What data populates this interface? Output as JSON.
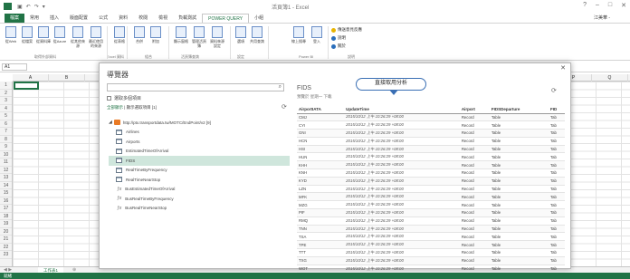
{
  "window": {
    "title": "活頁簿1 - Excel",
    "signin": "江美華 -"
  },
  "ribbon_tabs": [
    "檔案",
    "常用",
    "插入",
    "版面配置",
    "公式",
    "資料",
    "校閱",
    "檢視",
    "負載測試",
    "POWER QUERY",
    "小組"
  ],
  "ribbon": {
    "buttons": [
      {
        "label": "從Web",
        "icon": "web-icon"
      },
      {
        "label": "從檔案",
        "icon": "file-icon"
      },
      {
        "label": "從資料庫",
        "icon": "database-icon"
      },
      {
        "label": "從Azure",
        "icon": "azure-icon"
      },
      {
        "label": "從其他來源",
        "icon": "other-sources-icon"
      },
      {
        "label": "最近使用的來源",
        "icon": "recent-sources-icon"
      },
      {
        "label": "從表格",
        "icon": "table-icon"
      },
      {
        "label": "合併",
        "icon": "merge-icon"
      },
      {
        "label": "附加",
        "icon": "append-icon"
      },
      {
        "label": "顯示窗格",
        "icon": "pane-icon"
      },
      {
        "label": "管理活頁簿",
        "icon": "workbook-icon"
      },
      {
        "label": "資料來源設定",
        "icon": "datasource-icon"
      },
      {
        "label": "選項",
        "icon": "options-icon"
      },
      {
        "label": "共用查詢",
        "icon": "shared-icon"
      },
      {
        "label": "線上搜尋",
        "icon": "search-icon"
      },
      {
        "label": "登入",
        "icon": "signin-icon"
      }
    ],
    "groups": [
      "取得外部資料",
      "Excel 資料",
      "組合",
      "活頁簿查詢",
      "設定",
      "Power BI",
      "說明"
    ],
    "help_items": [
      "傳送意見反應",
      "說明",
      "關於"
    ]
  },
  "formula_bar": {
    "name_box": "A1"
  },
  "columns": [
    "A",
    "B",
    "C",
    "D",
    "E",
    "F",
    "G",
    "H",
    "I",
    "J",
    "K",
    "L",
    "M",
    "N",
    "O",
    "P",
    "Q"
  ],
  "rows": [
    "1",
    "2",
    "3",
    "4",
    "5",
    "6",
    "7",
    "8",
    "9",
    "10",
    "11",
    "12",
    "13",
    "14",
    "15",
    "16",
    "17",
    "18",
    "19",
    "20",
    "21",
    "22",
    "23"
  ],
  "sheet_tab": "工作表1",
  "status": "就緒",
  "navigator": {
    "title": "導覽器",
    "multi_select_label": "選取多個項目",
    "selection_prefix": "全部顯示",
    "selection_text": "| 顯示選取項目 [1]",
    "tree": [
      {
        "type": "root",
        "label": "http://ptx.transportdata.tw/MOTC/EndPoint/v2 [9]"
      },
      {
        "type": "table",
        "label": "Airlines"
      },
      {
        "type": "table",
        "label": "Airports"
      },
      {
        "type": "table",
        "label": "EstimatedTimeOfArrival"
      },
      {
        "type": "table",
        "label": "FIDS",
        "selected": true
      },
      {
        "type": "table",
        "label": "RealTimeByFrequency"
      },
      {
        "type": "table",
        "label": "RealTimeNearStop"
      },
      {
        "type": "function",
        "label": "BusEstimatedTimeOfArrival"
      },
      {
        "type": "function",
        "label": "BusRealTimeByFrequency"
      },
      {
        "type": "function",
        "label": "BusRealTimeNearStop"
      }
    ],
    "preview": {
      "title": "FIDS",
      "subtitle": "預覽於 星期一 下載",
      "callout": "直接取用分析",
      "columns": [
        "AirportIATA",
        "UpdateTime",
        "Airport",
        "FIDSDeparture",
        "FID"
      ],
      "rows": [
        [
          "CMJ",
          "2015/10/12 上午 10:26:29 +08:00",
          "Record",
          "Table",
          "Tab"
        ],
        [
          "CYI",
          "2015/10/12 上午 10:26:29 +08:00",
          "Record",
          "Table",
          "Tab"
        ],
        [
          "GNI",
          "2015/10/12 上午 10:26:29 +08:00",
          "Record",
          "Table",
          "Tab"
        ],
        [
          "HCN",
          "2015/10/12 上午 10:26:29 +08:00",
          "Record",
          "Table",
          "Tab"
        ],
        [
          "HSI",
          "2015/10/12 上午 10:26:29 +08:00",
          "Record",
          "Table",
          "Tab"
        ],
        [
          "HUN",
          "2015/10/12 上午 10:26:29 +08:00",
          "Record",
          "Table",
          "Tab"
        ],
        [
          "KHH",
          "2015/10/12 上午 10:26:29 +08:00",
          "Record",
          "Table",
          "Tab"
        ],
        [
          "KNH",
          "2015/10/12 上午 10:26:29 +08:00",
          "Record",
          "Table",
          "Tab"
        ],
        [
          "KYD",
          "2015/10/12 上午 10:26:29 +08:00",
          "Record",
          "Table",
          "Tab"
        ],
        [
          "LZN",
          "2015/10/12 上午 10:26:29 +08:00",
          "Record",
          "Table",
          "Tab"
        ],
        [
          "MFK",
          "2015/10/12 上午 10:26:29 +08:00",
          "Record",
          "Table",
          "Tab"
        ],
        [
          "MZG",
          "2015/10/12 上午 10:26:29 +08:00",
          "Record",
          "Table",
          "Tab"
        ],
        [
          "PIF",
          "2015/10/12 上午 10:26:29 +08:00",
          "Record",
          "Table",
          "Tab"
        ],
        [
          "RMQ",
          "2015/10/12 上午 10:26:29 +08:00",
          "Record",
          "Table",
          "Tab"
        ],
        [
          "TNN",
          "2015/10/12 上午 10:26:29 +08:00",
          "Record",
          "Table",
          "Tab"
        ],
        [
          "TSA",
          "2015/10/12 上午 10:26:29 +08:00",
          "Record",
          "Table",
          "Tab"
        ],
        [
          "TPE",
          "2015/10/12 上午 10:26:29 +08:00",
          "Record",
          "Table",
          "Tab"
        ],
        [
          "TTT",
          "2015/10/12 上午 10:26:29 +08:00",
          "Record",
          "Table",
          "Tab"
        ],
        [
          "TXG",
          "2015/10/12 上午 10:26:29 +08:00",
          "Record",
          "Table",
          "Tab"
        ],
        [
          "WOT",
          "2015/10/12 上午 10:26:29 +08:00",
          "Record",
          "Table",
          "Tab"
        ]
      ]
    }
  },
  "colors": {
    "excel_green": "#217346",
    "callout_border": "#3a6fb4",
    "selected_row": "#cfe6dc"
  }
}
